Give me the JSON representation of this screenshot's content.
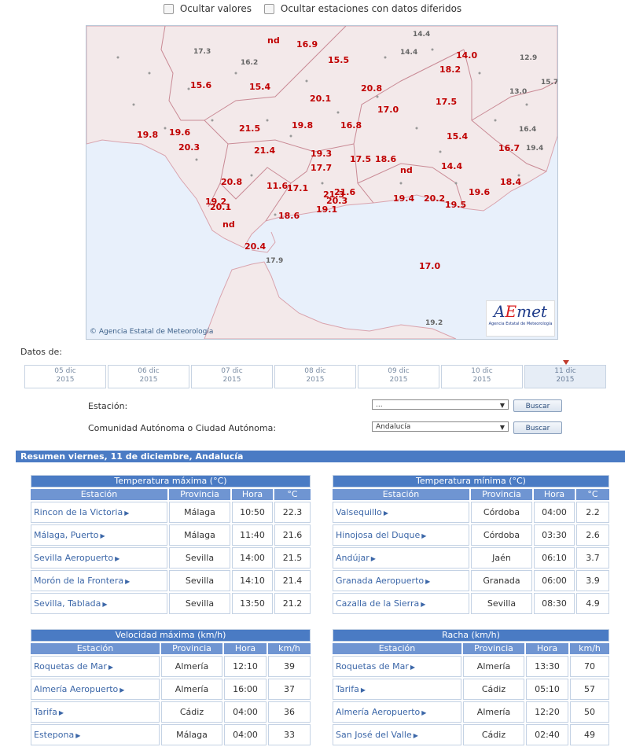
{
  "top_options": [
    {
      "label": "Ocultar valores",
      "checked": false
    },
    {
      "label": "Ocultar estaciones con datos diferidos",
      "checked": false
    }
  ],
  "map": {
    "credit": "Agencia Estatal de Meteorología",
    "logo_text": "AEmet",
    "logo_sub": "Agencia Estatal de Meteorología",
    "values_red": [
      "16.9",
      "15.5",
      "14.0",
      "18.2",
      "15.6",
      "15.4",
      "20.8",
      "20.1",
      "17.0",
      "17.5",
      "19.8",
      "19.6",
      "21.5",
      "19.8",
      "16.8",
      "20.3",
      "21.4",
      "19.3",
      "15.4",
      "16.7",
      "17.7",
      "17.5",
      "18.6",
      "14.4",
      "18.4",
      "20.8",
      "11.6",
      "17.1",
      "21.3",
      "21.6",
      "19.2",
      "20.3",
      "20.1",
      "19.1",
      "19.4",
      "20.2",
      "19.6",
      "19.5",
      "18.6",
      "nd",
      "nd",
      "20.4",
      "17.0"
    ],
    "values_gray": [
      "14.4",
      "17.3",
      "16.2",
      "14.4",
      "12.9",
      "15.7",
      "13.0",
      "16.4",
      "19.4",
      "17.9",
      "19.2"
    ],
    "nd_label": "nd"
  },
  "datos_label": "Datos de:",
  "dates": [
    {
      "day": "05 dic",
      "year": "2015"
    },
    {
      "day": "06 dic",
      "year": "2015"
    },
    {
      "day": "07 dic",
      "year": "2015"
    },
    {
      "day": "08 dic",
      "year": "2015"
    },
    {
      "day": "09 dic",
      "year": "2015"
    },
    {
      "day": "10 dic",
      "year": "2015"
    },
    {
      "day": "11 dic",
      "year": "2015"
    }
  ],
  "form": {
    "station_label": "Estación:",
    "station_value": "...",
    "ccaa_label": "Comunidad Autónoma o Ciudad Autónoma:",
    "ccaa_value": "Andalucía",
    "search_label": "Buscar"
  },
  "resumen_title": "Resumen viernes, 11 de diciembre, Andalucía",
  "tables": {
    "tmax": {
      "title": "Temperatura máxima (°C)",
      "headers": [
        "Estación",
        "Provincia",
        "Hora",
        "°C"
      ],
      "rows": [
        [
          "Rincon de la Victoria",
          "Málaga",
          "10:50",
          "22.3"
        ],
        [
          "Málaga, Puerto",
          "Málaga",
          "11:40",
          "21.6"
        ],
        [
          "Sevilla Aeropuerto",
          "Sevilla",
          "14:00",
          "21.5"
        ],
        [
          "Morón de la Frontera",
          "Sevilla",
          "14:10",
          "21.4"
        ],
        [
          "Sevilla, Tablada",
          "Sevilla",
          "13:50",
          "21.2"
        ]
      ]
    },
    "tmin": {
      "title": "Temperatura mínima (°C)",
      "headers": [
        "Estación",
        "Provincia",
        "Hora",
        "°C"
      ],
      "rows": [
        [
          "Valsequillo",
          "Córdoba",
          "04:00",
          "2.2"
        ],
        [
          "Hinojosa del Duque",
          "Córdoba",
          "03:30",
          "2.6"
        ],
        [
          "Andújar",
          "Jaén",
          "06:10",
          "3.7"
        ],
        [
          "Granada Aeropuerto",
          "Granada",
          "06:00",
          "3.9"
        ],
        [
          "Cazalla de la Sierra",
          "Sevilla",
          "08:30",
          "4.9"
        ]
      ]
    },
    "vmax": {
      "title": "Velocidad máxima (km/h)",
      "headers": [
        "Estación",
        "Provincia",
        "Hora",
        "km/h"
      ],
      "rows": [
        [
          "Roquetas de Mar",
          "Almería",
          "12:10",
          "39"
        ],
        [
          "Almería Aeropuerto",
          "Almería",
          "16:00",
          "37"
        ],
        [
          "Tarifa",
          "Cádiz",
          "04:00",
          "36"
        ],
        [
          "Estepona",
          "Málaga",
          "04:00",
          "33"
        ]
      ]
    },
    "racha": {
      "title": "Racha (km/h)",
      "headers": [
        "Estación",
        "Provincia",
        "Hora",
        "km/h"
      ],
      "rows": [
        [
          "Roquetas de Mar",
          "Almería",
          "13:30",
          "70"
        ],
        [
          "Tarifa",
          "Cádiz",
          "05:10",
          "57"
        ],
        [
          "Almería Aeropuerto",
          "Almería",
          "12:20",
          "50"
        ],
        [
          "San José del Valle",
          "Cádiz",
          "02:40",
          "49"
        ]
      ]
    }
  }
}
